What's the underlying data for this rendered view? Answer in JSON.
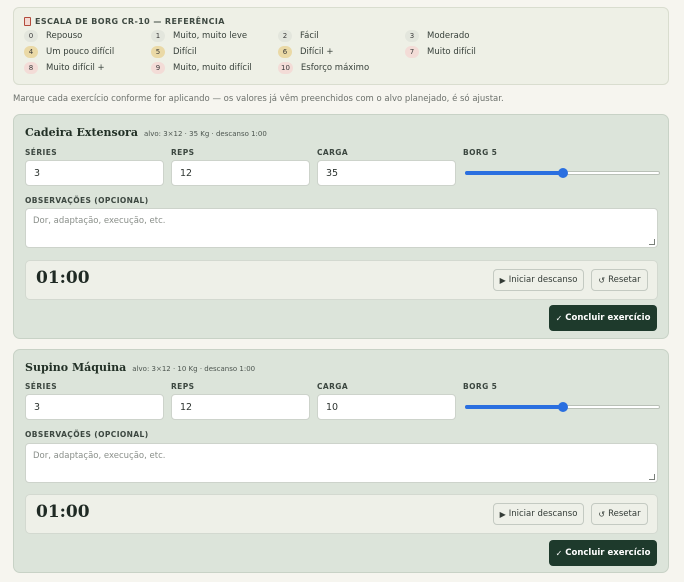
{
  "scale": {
    "title": "ESCALA DE BORG CR-10 — REFERÊNCIA",
    "items": [
      {
        "num": "0",
        "label": "Repouso",
        "color": "#e3e6dd"
      },
      {
        "num": "1",
        "label": "Muito, muito leve",
        "color": "#e3e6dd"
      },
      {
        "num": "2",
        "label": "Fácil",
        "color": "#e3e6dd"
      },
      {
        "num": "3",
        "label": "Moderado",
        "color": "#e3e6dd"
      },
      {
        "num": "4",
        "label": "Um pouco difícil",
        "color": "#ead9a6"
      },
      {
        "num": "5",
        "label": "Difícil",
        "color": "#ead9a6"
      },
      {
        "num": "6",
        "label": "Difícil +",
        "color": "#ead9a6"
      },
      {
        "num": "7",
        "label": "Muito difícil",
        "color": "#f3dcd7"
      },
      {
        "num": "8",
        "label": "Muito difícil +",
        "color": "#f3dcd7"
      },
      {
        "num": "9",
        "label": "Muito, muito difícil",
        "color": "#f3dcd7"
      },
      {
        "num": "10",
        "label": "Esforço máximo",
        "color": "#f3dcd7"
      }
    ]
  },
  "intro": "Marque cada exercício conforme for aplicando — os valores já vêm preenchidos com o alvo planejado, é só ajustar.",
  "labels": {
    "series": "SÉRIES",
    "reps": "REPS",
    "carga": "CARGA",
    "notes": "OBSERVAÇÕES (OPCIONAL)",
    "notes_placeholder": "Dor, adaptação, execução, etc.",
    "start": "Iniciar descanso",
    "reset": "Resetar",
    "done": "Concluir exercício"
  },
  "exercises": [
    {
      "name": "Cadeira Extensora",
      "meta": "alvo: 3×12 · 35 Kg · descanso 1:00",
      "series": "3",
      "reps": "12",
      "carga": "35",
      "borg_label": "BORG 5",
      "borg_fraction": 0.5,
      "timer": "01:00"
    },
    {
      "name": "Supino Máquina",
      "meta": "alvo: 3×12 · 10 Kg · descanso 1:00",
      "series": "3",
      "reps": "12",
      "carga": "10",
      "borg_label": "BORG 5",
      "borg_fraction": 0.5,
      "timer": "01:00"
    }
  ]
}
